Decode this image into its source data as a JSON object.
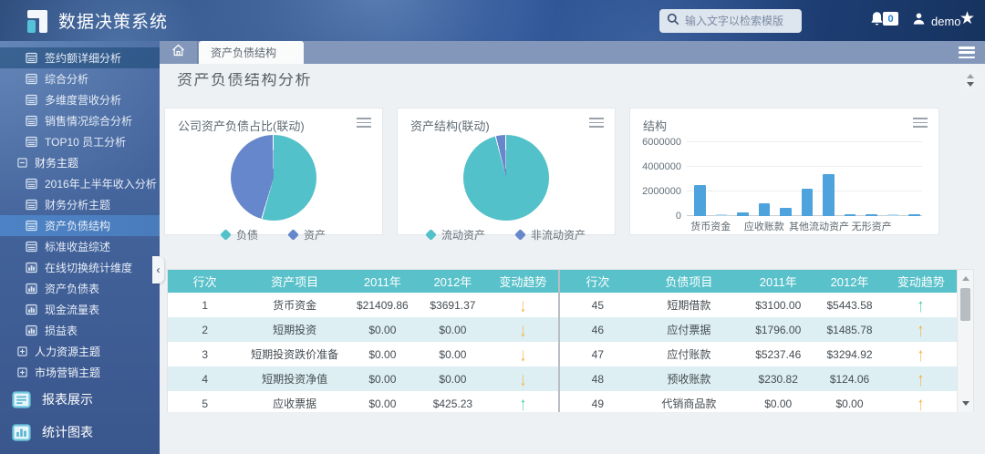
{
  "header": {
    "app_title": "数据决策系统",
    "search_placeholder": "输入文字以检索模版",
    "notification_count": "0",
    "username": "demo"
  },
  "tabbar": {
    "active_tab": "资产负债结构"
  },
  "page": {
    "title": "资产负债结构分析"
  },
  "icons": [
    "logo-icon",
    "search-icon",
    "bell-icon",
    "user-icon",
    "star-icon",
    "home-icon",
    "menu-icon",
    "report-icon",
    "chart-icon",
    "collapse-minus-icon",
    "expand-plus-icon",
    "reports-icon",
    "charts-icon",
    "trend-up-icon",
    "trend-down-icon",
    "sidebar-collapse-icon"
  ],
  "sidebar": {
    "items": [
      {
        "label": "签约额详细分析",
        "icon": "report-icon",
        "kind": "item",
        "state": "hover"
      },
      {
        "label": "综合分析",
        "icon": "report-icon",
        "kind": "item"
      },
      {
        "label": "多维度营收分析",
        "icon": "report-icon",
        "kind": "item"
      },
      {
        "label": "销售情况综合分析",
        "icon": "report-icon",
        "kind": "item"
      },
      {
        "label": "TOP10 员工分析",
        "icon": "report-icon",
        "kind": "item"
      },
      {
        "label": "财务主题",
        "icon": "collapse-minus-icon",
        "kind": "group"
      },
      {
        "label": "2016年上半年收入分析",
        "icon": "report-icon",
        "kind": "item"
      },
      {
        "label": "财务分析主题",
        "icon": "report-icon",
        "kind": "item"
      },
      {
        "label": "资产负债结构",
        "icon": "report-icon",
        "kind": "item",
        "state": "active"
      },
      {
        "label": "标准收益综述",
        "icon": "report-icon",
        "kind": "item"
      },
      {
        "label": "在线切换统计维度",
        "icon": "chart-icon",
        "kind": "item"
      },
      {
        "label": "资产负债表",
        "icon": "chart-icon",
        "kind": "item"
      },
      {
        "label": "现金流量表",
        "icon": "chart-icon",
        "kind": "item"
      },
      {
        "label": "损益表",
        "icon": "chart-icon",
        "kind": "item"
      },
      {
        "label": "人力资源主题",
        "icon": "expand-plus-icon",
        "kind": "group"
      },
      {
        "label": "市场营销主题",
        "icon": "expand-plus-icon",
        "kind": "group"
      },
      {
        "label": "报表展示",
        "icon": "reports-icon",
        "kind": "section"
      },
      {
        "label": "统计图表",
        "icon": "charts-icon",
        "kind": "section"
      }
    ]
  },
  "chart_data": [
    {
      "type": "pie",
      "title": "公司资产负债占比(联动)",
      "slices": [
        {
          "label": "负债",
          "value": 54.7,
          "color": "#53c1c9"
        },
        {
          "label": "资产",
          "value": 45.3,
          "color": "#6687cb"
        }
      ],
      "legend_position": "bottom"
    },
    {
      "type": "pie",
      "title": "资产结构(联动)",
      "slices": [
        {
          "label": "流动资产",
          "value": 96.2,
          "color": "#53c1c9"
        },
        {
          "label": "非流动资产",
          "value": 3.8,
          "color": "#6687cb"
        }
      ],
      "legend_position": "bottom"
    },
    {
      "type": "bar",
      "title": "结构",
      "ylim": [
        0,
        6000000
      ],
      "yticks": [
        0,
        2000000,
        4000000,
        6000000
      ],
      "grid": true,
      "bars": [
        {
          "value": 2550000,
          "label": "货币资金",
          "color": "#4ea3dc"
        },
        {
          "value": 70000,
          "color": "#b5d9ef"
        },
        {
          "value": 300000,
          "color": "#4ea3dc"
        },
        {
          "value": 1050000,
          "label": "应收账款",
          "color": "#4ea3dc"
        },
        {
          "value": 650000,
          "color": "#4ea3dc"
        },
        {
          "value": 2200000,
          "label": "其他流动资产",
          "color": "#4ea3dc"
        },
        {
          "value": 3400000,
          "color": "#4ea3dc"
        },
        {
          "value": 110000,
          "color": "#4ea3dc"
        },
        {
          "value": 170000,
          "label": "无形资产",
          "color": "#4ea3dc"
        },
        {
          "value": 60000,
          "color": "#b5d9ef"
        },
        {
          "value": 120000,
          "color": "#4ea3dc"
        }
      ]
    }
  ],
  "tables": {
    "assets": {
      "columns": [
        "行次",
        "资产项目",
        "2011年",
        "2012年",
        "变动趋势"
      ],
      "rows": [
        [
          "1",
          "货币资金",
          "$21409.86",
          "$3691.37",
          "down-orange"
        ],
        [
          "2",
          "短期投资",
          "$0.00",
          "$0.00",
          "down-orange"
        ],
        [
          "3",
          "短期投资跌价准备",
          "$0.00",
          "$0.00",
          "down-orange"
        ],
        [
          "4",
          "短期投资净值",
          "$0.00",
          "$0.00",
          "down-orange"
        ],
        [
          "5",
          "应收票据",
          "$0.00",
          "$425.23",
          "up-green"
        ]
      ]
    },
    "liabilities": {
      "columns": [
        "行次",
        "负债项目",
        "2011年",
        "2012年",
        "变动趋势"
      ],
      "rows": [
        [
          "45",
          "短期借款",
          "$3100.00",
          "$5443.58",
          "up-green"
        ],
        [
          "46",
          "应付票据",
          "$1796.00",
          "$1485.78",
          "up-orange"
        ],
        [
          "47",
          "应付账款",
          "$5237.46",
          "$3294.92",
          "up-orange"
        ],
        [
          "48",
          "预收账款",
          "$230.82",
          "$124.06",
          "up-orange"
        ],
        [
          "49",
          "代销商品款",
          "$0.00",
          "$0.00",
          "up-orange"
        ]
      ]
    }
  },
  "colors": {
    "accent_teal": "#53c1c9",
    "accent_blue": "#6687cb",
    "bar_blue": "#4ea3dc",
    "table_header": "#58c1ca",
    "row_alt": "#ddeff3",
    "arrow_orange": "#f5b03e",
    "arrow_green": "#45cfa2"
  }
}
